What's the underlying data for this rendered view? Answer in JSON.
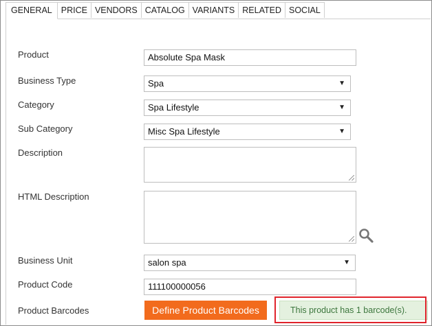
{
  "tabs": [
    {
      "label": "GENERAL",
      "active": true
    },
    {
      "label": "PRICE"
    },
    {
      "label": "VENDORS"
    },
    {
      "label": "CATALOG"
    },
    {
      "label": "VARIANTS"
    },
    {
      "label": "RELATED"
    },
    {
      "label": "SOCIAL"
    }
  ],
  "form": {
    "product": {
      "label": "Product",
      "value": "Absolute Spa Mask"
    },
    "business_type": {
      "label": "Business Type",
      "value": "Spa"
    },
    "category": {
      "label": "Category",
      "value": "Spa Lifestyle"
    },
    "sub_category": {
      "label": "Sub Category",
      "value": "Misc Spa Lifestyle"
    },
    "description": {
      "label": "Description",
      "value": ""
    },
    "html_description": {
      "label": "HTML Description",
      "value": ""
    },
    "business_unit": {
      "label": "Business Unit",
      "value": "salon spa"
    },
    "product_code": {
      "label": "Product Code",
      "value": "111100000056"
    },
    "product_barcodes": {
      "label": "Product Barcodes",
      "button_label": "Define Product Barcodes",
      "notice": "This product has 1 barcode(s)."
    }
  },
  "icons": {
    "dropdown_arrow": "▼",
    "search": "search-icon"
  },
  "colors": {
    "button": "#f26b1d",
    "notice_bg": "#e4f1df",
    "notice_text": "#3c763d",
    "highlight": "#e0232b"
  }
}
